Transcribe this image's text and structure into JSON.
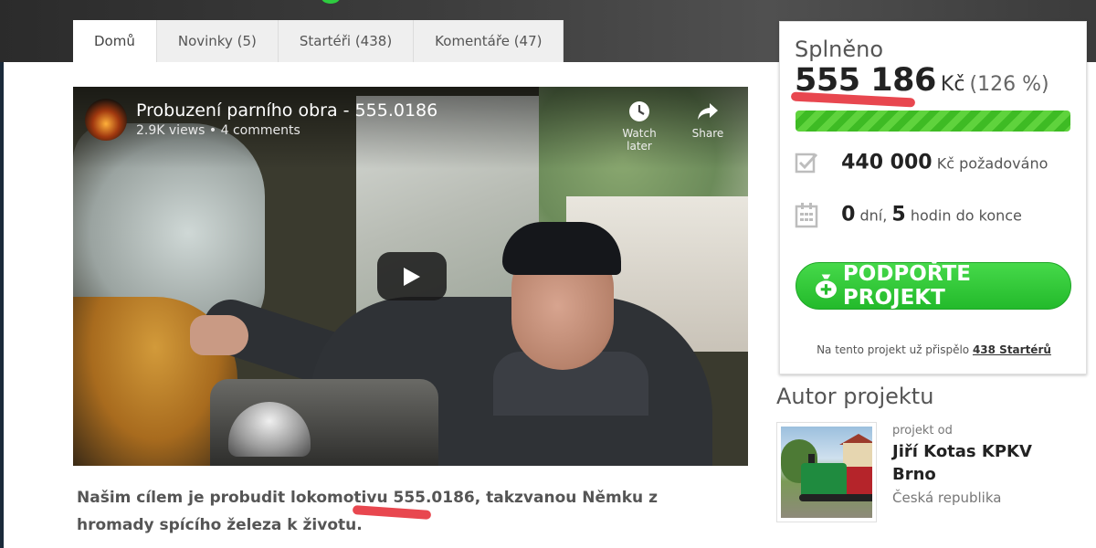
{
  "tabs": [
    {
      "label": "Domů",
      "active": true
    },
    {
      "label": "Novinky (5)",
      "active": false
    },
    {
      "label": "Startéři (438)",
      "active": false
    },
    {
      "label": "Komentáře (47)",
      "active": false
    }
  ],
  "video": {
    "title": "Probuzení parního obra - 555.0186",
    "meta": "2.9K views • 4 comments",
    "watch_later": "Watch later",
    "share": "Share"
  },
  "description": {
    "before": "Našim cílem je probudit lokomotivu ",
    "highlight": "555.0186",
    "after": ", takzvanou Němku z hromady spícího železa k životu."
  },
  "stats": {
    "splneno_label": "Splněno",
    "raised_amount": "555 186",
    "currency": "Kč",
    "percent_text": "(126 %)",
    "progress_percent": 126,
    "goal_amount": "440 000",
    "goal_label": "Kč požadováno",
    "days": "0",
    "days_label": "dní,",
    "hours": "5",
    "hours_label": "hodin do konce",
    "support_button": "PODPOŘTE PROJEKT",
    "contrib_text": "Na tento projekt už přispělo",
    "contrib_link": "438 Startérů"
  },
  "author": {
    "section_title": "Autor projektu",
    "by_label": "projekt od",
    "name": "Jiří Kotas KPKV Brno",
    "country": "Česká republika"
  },
  "colors": {
    "accent_green": "#2ecc40",
    "highlight_red": "#e8474f"
  }
}
